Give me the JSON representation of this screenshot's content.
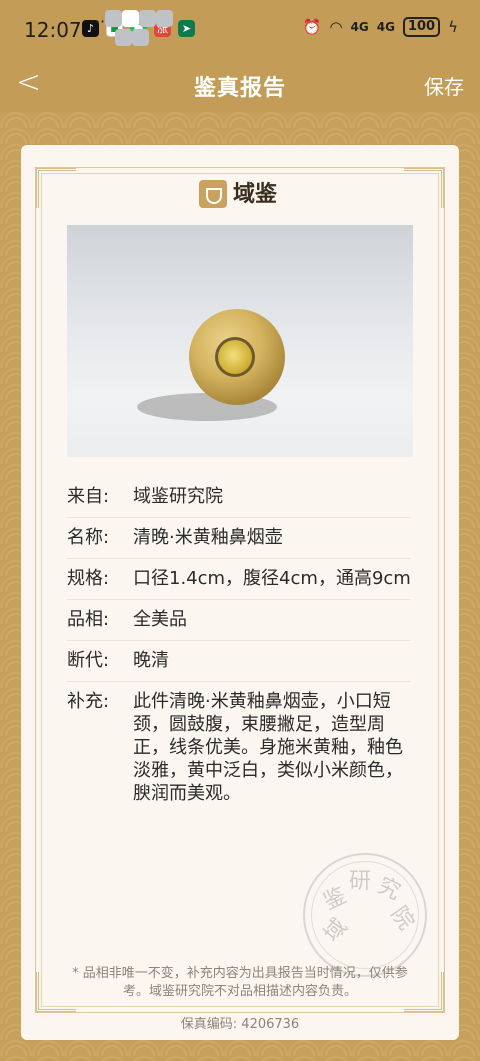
{
  "status_bar": {
    "time": "12:07",
    "network_1": "4G",
    "network_2": "4G",
    "battery": "100"
  },
  "nav": {
    "title": "鉴真报告",
    "save_label": "保存"
  },
  "logo": {
    "name": "域鉴"
  },
  "photo": {
    "slide_count": 6,
    "active_index": 1
  },
  "info": [
    {
      "label": "来自:",
      "value": "域鉴研究院"
    },
    {
      "label": "名称:",
      "value": "清晚·米黄釉鼻烟壶"
    },
    {
      "label": "规格:",
      "value": "口径1.4cm，腹径4cm，通高9cm"
    },
    {
      "label": "品相:",
      "value": "全美品"
    },
    {
      "label": "断代:",
      "value": "晚清"
    },
    {
      "label": "补充:",
      "value": "此件清晚·米黄釉鼻烟壶，小口短颈，圆鼓腹，束腰撇足，造型周正，线条优美。身施米黄釉，釉色淡雅，黄中泛白，类似小米颜色，腴润而美观。"
    }
  ],
  "seal": {
    "text": [
      "域",
      "鉴",
      "研",
      "究",
      "院"
    ]
  },
  "note": "* 品相非唯一不变，补充内容为出具报告当时情况，仅供参考。域鉴研究院不对品相描述内容负责。",
  "code": "保真编码:  4206736"
}
